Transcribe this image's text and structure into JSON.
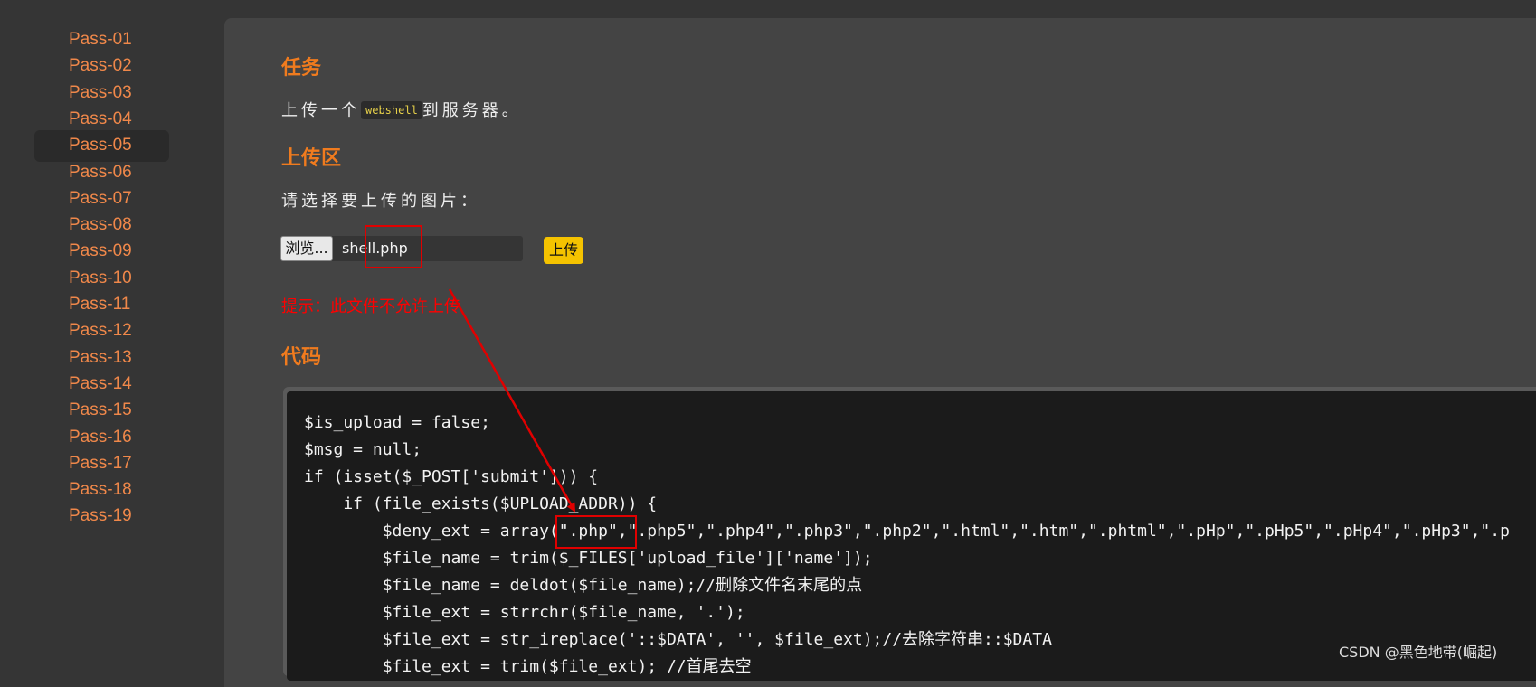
{
  "sidebar": {
    "items": [
      "Pass-01",
      "Pass-02",
      "Pass-03",
      "Pass-04",
      "Pass-05",
      "Pass-06",
      "Pass-07",
      "Pass-08",
      "Pass-09",
      "Pass-10",
      "Pass-11",
      "Pass-12",
      "Pass-13",
      "Pass-14",
      "Pass-15",
      "Pass-16",
      "Pass-17",
      "Pass-18",
      "Pass-19"
    ],
    "active": "Pass-05"
  },
  "task": {
    "heading": "任务",
    "text_before": "上传一个",
    "code": "webshell",
    "text_after": "到服务器。"
  },
  "upload": {
    "heading": "上传区",
    "prompt": "请选择要上传的图片：",
    "browse_label": "浏览...",
    "file_name": "shell.php",
    "submit_label": "上传",
    "hint": "提示：此文件不允许上传"
  },
  "code": {
    "heading": "代码",
    "lines": [
      "$is_upload = false;",
      "$msg = null;",
      "if (isset($_POST['submit'])) {",
      "    if (file_exists($UPLOAD_ADDR)) {",
      "        $deny_ext = array(\".php\",\".php5\",\".php4\",\".php3\",\".php2\",\".html\",\".htm\",\".phtml\",\".pHp\",\".pHp5\",\".pHp4\",\".pHp3\",\".p",
      "        $file_name = trim($_FILES['upload_file']['name']);",
      "        $file_name = deldot($file_name);//删除文件名末尾的点",
      "        $file_ext = strrchr($file_name, '.');",
      "        $file_ext = str_ireplace('::$DATA', '', $file_ext);//去除字符串::$DATA",
      "        $file_ext = trim($file_ext); //首尾去空"
    ]
  },
  "watermark": "CSDN @黑色地带(崛起)",
  "colors": {
    "accent_orange": "#f07b1e",
    "nav_link": "#f0884a",
    "hint_red": "#ff0000",
    "annotation_red": "#e00000",
    "upload_button": "#f5c300"
  }
}
